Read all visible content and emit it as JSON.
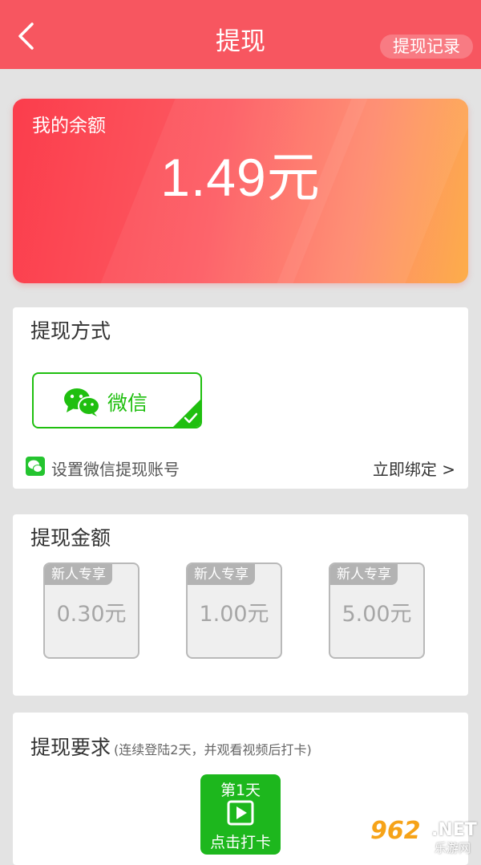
{
  "header": {
    "title": "提现",
    "record_label": "提现记录"
  },
  "balance": {
    "label": "我的余额",
    "amount": "1.49元"
  },
  "method": {
    "title": "提现方式",
    "option_label": "微信",
    "bind_text": "设置微信提现账号",
    "bind_link": "立即绑定 >"
  },
  "amounts": {
    "title": "提现金额",
    "options": [
      {
        "tag": "新人专享",
        "price": "0.30元"
      },
      {
        "tag": "新人专享",
        "price": "1.00元"
      },
      {
        "tag": "新人专享",
        "price": "5.00元"
      }
    ]
  },
  "requirement": {
    "title": "提现要求",
    "note": "(连续登陆2天，并观看视频后打卡)",
    "day_label": "第1天",
    "action_label": "点击打卡"
  },
  "watermark": {
    "number": "962",
    "net": ".NET",
    "site": "乐游网"
  },
  "colors": {
    "header": "#f75660",
    "wechat_green": "#1fbf0f",
    "checkin_green": "#1db71d"
  },
  "icons": [
    "back-arrow-icon",
    "wechat-icon",
    "check-icon",
    "play-icon"
  ]
}
